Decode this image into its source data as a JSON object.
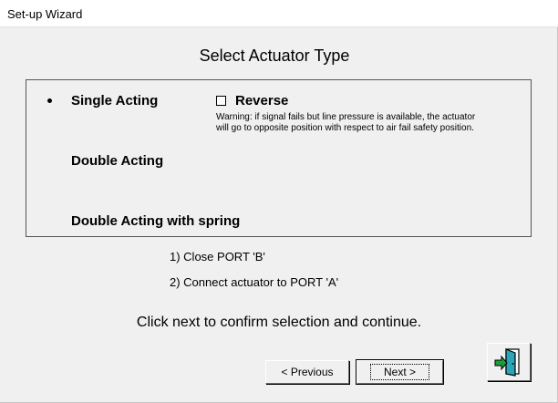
{
  "window": {
    "title": "Set-up Wizard"
  },
  "page": {
    "heading": "Select Actuator Type"
  },
  "actuator_options": [
    {
      "label": "Single Acting",
      "selected": true
    },
    {
      "label": "Double Acting",
      "selected": false
    },
    {
      "label": "Double Acting with spring",
      "selected": false
    }
  ],
  "reverse": {
    "label": "Reverse",
    "checked": false,
    "warning_line1": "Warning: if signal fails but line pressure is available, the actuator",
    "warning_line2": "will go to opposite position with respect to air fail safety position."
  },
  "instructions": {
    "step1": "1) Close PORT 'B'",
    "step2": "2) Connect actuator to PORT 'A'"
  },
  "footer": {
    "confirm_text": "Click next to confirm selection and continue.",
    "previous_label": "< Previous",
    "next_label": "Next >",
    "exit_icon": "exit-door-icon"
  },
  "colors": {
    "background": "#f0f0f0",
    "exit_icon_teal": "#2aa6b8",
    "exit_icon_green": "#1e9e3a"
  }
}
